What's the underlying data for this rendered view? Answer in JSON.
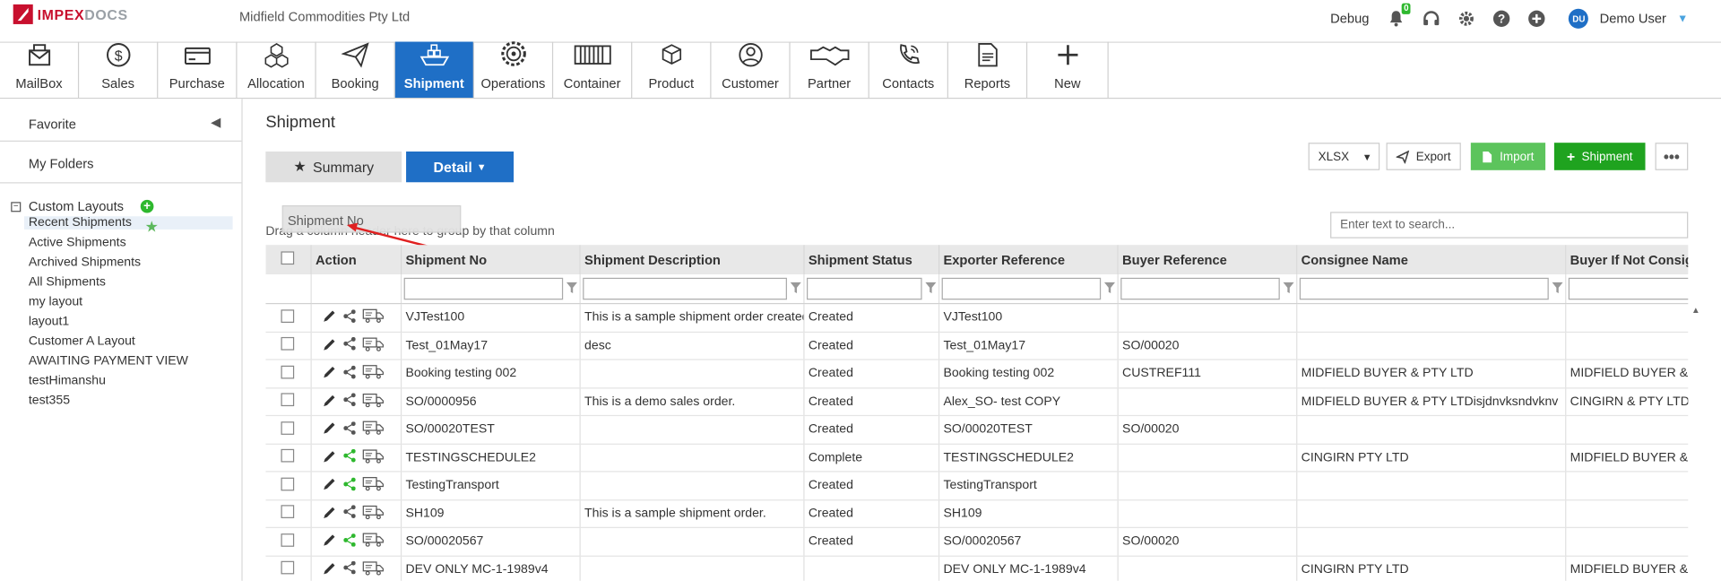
{
  "app": {
    "logo_main": "IMPEX",
    "logo_sub": "DOCS",
    "company": "Midfield Commodities Pty Ltd",
    "debug_label": "Debug",
    "notif_count": "0",
    "user_initials": "DU",
    "user_name": "Demo User"
  },
  "modules": [
    {
      "label": "MailBox",
      "icon": "mailbox-icon"
    },
    {
      "label": "Sales",
      "icon": "dollar-icon"
    },
    {
      "label": "Purchase",
      "icon": "card-icon"
    },
    {
      "label": "Allocation",
      "icon": "boxes-icon"
    },
    {
      "label": "Booking",
      "icon": "paper-plane-icon"
    },
    {
      "label": "Shipment",
      "icon": "ship-icon"
    },
    {
      "label": "Operations",
      "icon": "gear-icon"
    },
    {
      "label": "Container",
      "icon": "container-icon"
    },
    {
      "label": "Product",
      "icon": "product-icon"
    },
    {
      "label": "Customer",
      "icon": "customer-icon"
    },
    {
      "label": "Partner",
      "icon": "handshake-icon"
    },
    {
      "label": "Contacts",
      "icon": "phone-icon"
    },
    {
      "label": "Reports",
      "icon": "report-icon"
    },
    {
      "label": "New",
      "icon": "plus-icon"
    }
  ],
  "active_module": "Shipment",
  "sidebar": {
    "favorite": "Favorite",
    "my_folders": "My Folders",
    "custom_layouts": "Custom Layouts",
    "layouts": [
      "Recent Shipments",
      "Active Shipments",
      "Archived Shipments",
      "All Shipments",
      "my layout",
      "layout1",
      "Customer A Layout",
      "AWAITING PAYMENT VIEW",
      "testHimanshu",
      "test355"
    ]
  },
  "main": {
    "title": "Shipment",
    "summary_label": "Summary",
    "detail_label": "Detail",
    "format_value": "XLSX",
    "export_label": "Export",
    "import_label": "Import",
    "shipment_label": "Shipment",
    "search_placeholder": "Enter text to search...",
    "group_hint": "Drag a column header here to group by that column",
    "drag_ghost": "Shipment No"
  },
  "grid": {
    "columns": [
      "Action",
      "Shipment No",
      "Shipment Description",
      "Shipment Status",
      "Exporter Reference",
      "Buyer Reference",
      "Consignee Name",
      "Buyer If Not Consignee"
    ],
    "rows": [
      {
        "no": "VJTest100",
        "desc": "This is a sample shipment order created",
        "status": "Created",
        "exp": "VJTest100",
        "buyer": "",
        "consignee": "",
        "bnc": "",
        "share_green": false
      },
      {
        "no": "Test_01May17",
        "desc": "desc",
        "status": "Created",
        "exp": "Test_01May17",
        "buyer": "SO/00020",
        "consignee": "",
        "bnc": "",
        "share_green": false
      },
      {
        "no": "Booking testing 002",
        "desc": "",
        "status": "Created",
        "exp": "Booking testing 002",
        "buyer": "CUSTREF111",
        "consignee": "MIDFIELD BUYER & PTY LTD",
        "bnc": "MIDFIELD BUYER & PTY LTD",
        "share_green": false
      },
      {
        "no": "SO/0000956",
        "desc": "This is a demo sales order.",
        "status": "Created",
        "exp": "Alex_SO- test COPY",
        "buyer": "",
        "consignee": "MIDFIELD BUYER & PTY LTDisjdnvksndvknv",
        "bnc": "CINGIRN & PTY LTD",
        "share_green": false
      },
      {
        "no": "SO/00020TEST",
        "desc": "",
        "status": "Created",
        "exp": "SO/00020TEST",
        "buyer": "SO/00020",
        "consignee": "",
        "bnc": "",
        "share_green": false
      },
      {
        "no": "TESTINGSCHEDULE2",
        "desc": "",
        "status": "Complete",
        "exp": "TESTINGSCHEDULE2",
        "buyer": "",
        "consignee": "CINGIRN PTY LTD",
        "bnc": "MIDFIELD BUYER & PTY LTD",
        "share_green": true
      },
      {
        "no": "TestingTransport",
        "desc": "",
        "status": "Created",
        "exp": "TestingTransport",
        "buyer": "",
        "consignee": "",
        "bnc": "",
        "share_green": true
      },
      {
        "no": "SH109",
        "desc": "This is a sample shipment order.",
        "status": "Created",
        "exp": "SH109",
        "buyer": "",
        "consignee": "",
        "bnc": "",
        "share_green": false
      },
      {
        "no": "SO/00020567",
        "desc": "",
        "status": "Created",
        "exp": "SO/00020567",
        "buyer": "SO/00020",
        "consignee": "",
        "bnc": "",
        "share_green": true
      },
      {
        "no": "DEV ONLY MC-1-1989v4",
        "desc": "",
        "status": "",
        "exp": "DEV ONLY MC-1-1989v4",
        "buyer": "",
        "consignee": "CINGIRN PTY LTD",
        "bnc": "MIDFIELD BUYER & PTY LTD",
        "share_green": false
      }
    ]
  },
  "colors": {
    "primary": "#1f6fc6",
    "success": "#1fa31f",
    "import": "#5cc45c",
    "brand": "#c8102e"
  }
}
